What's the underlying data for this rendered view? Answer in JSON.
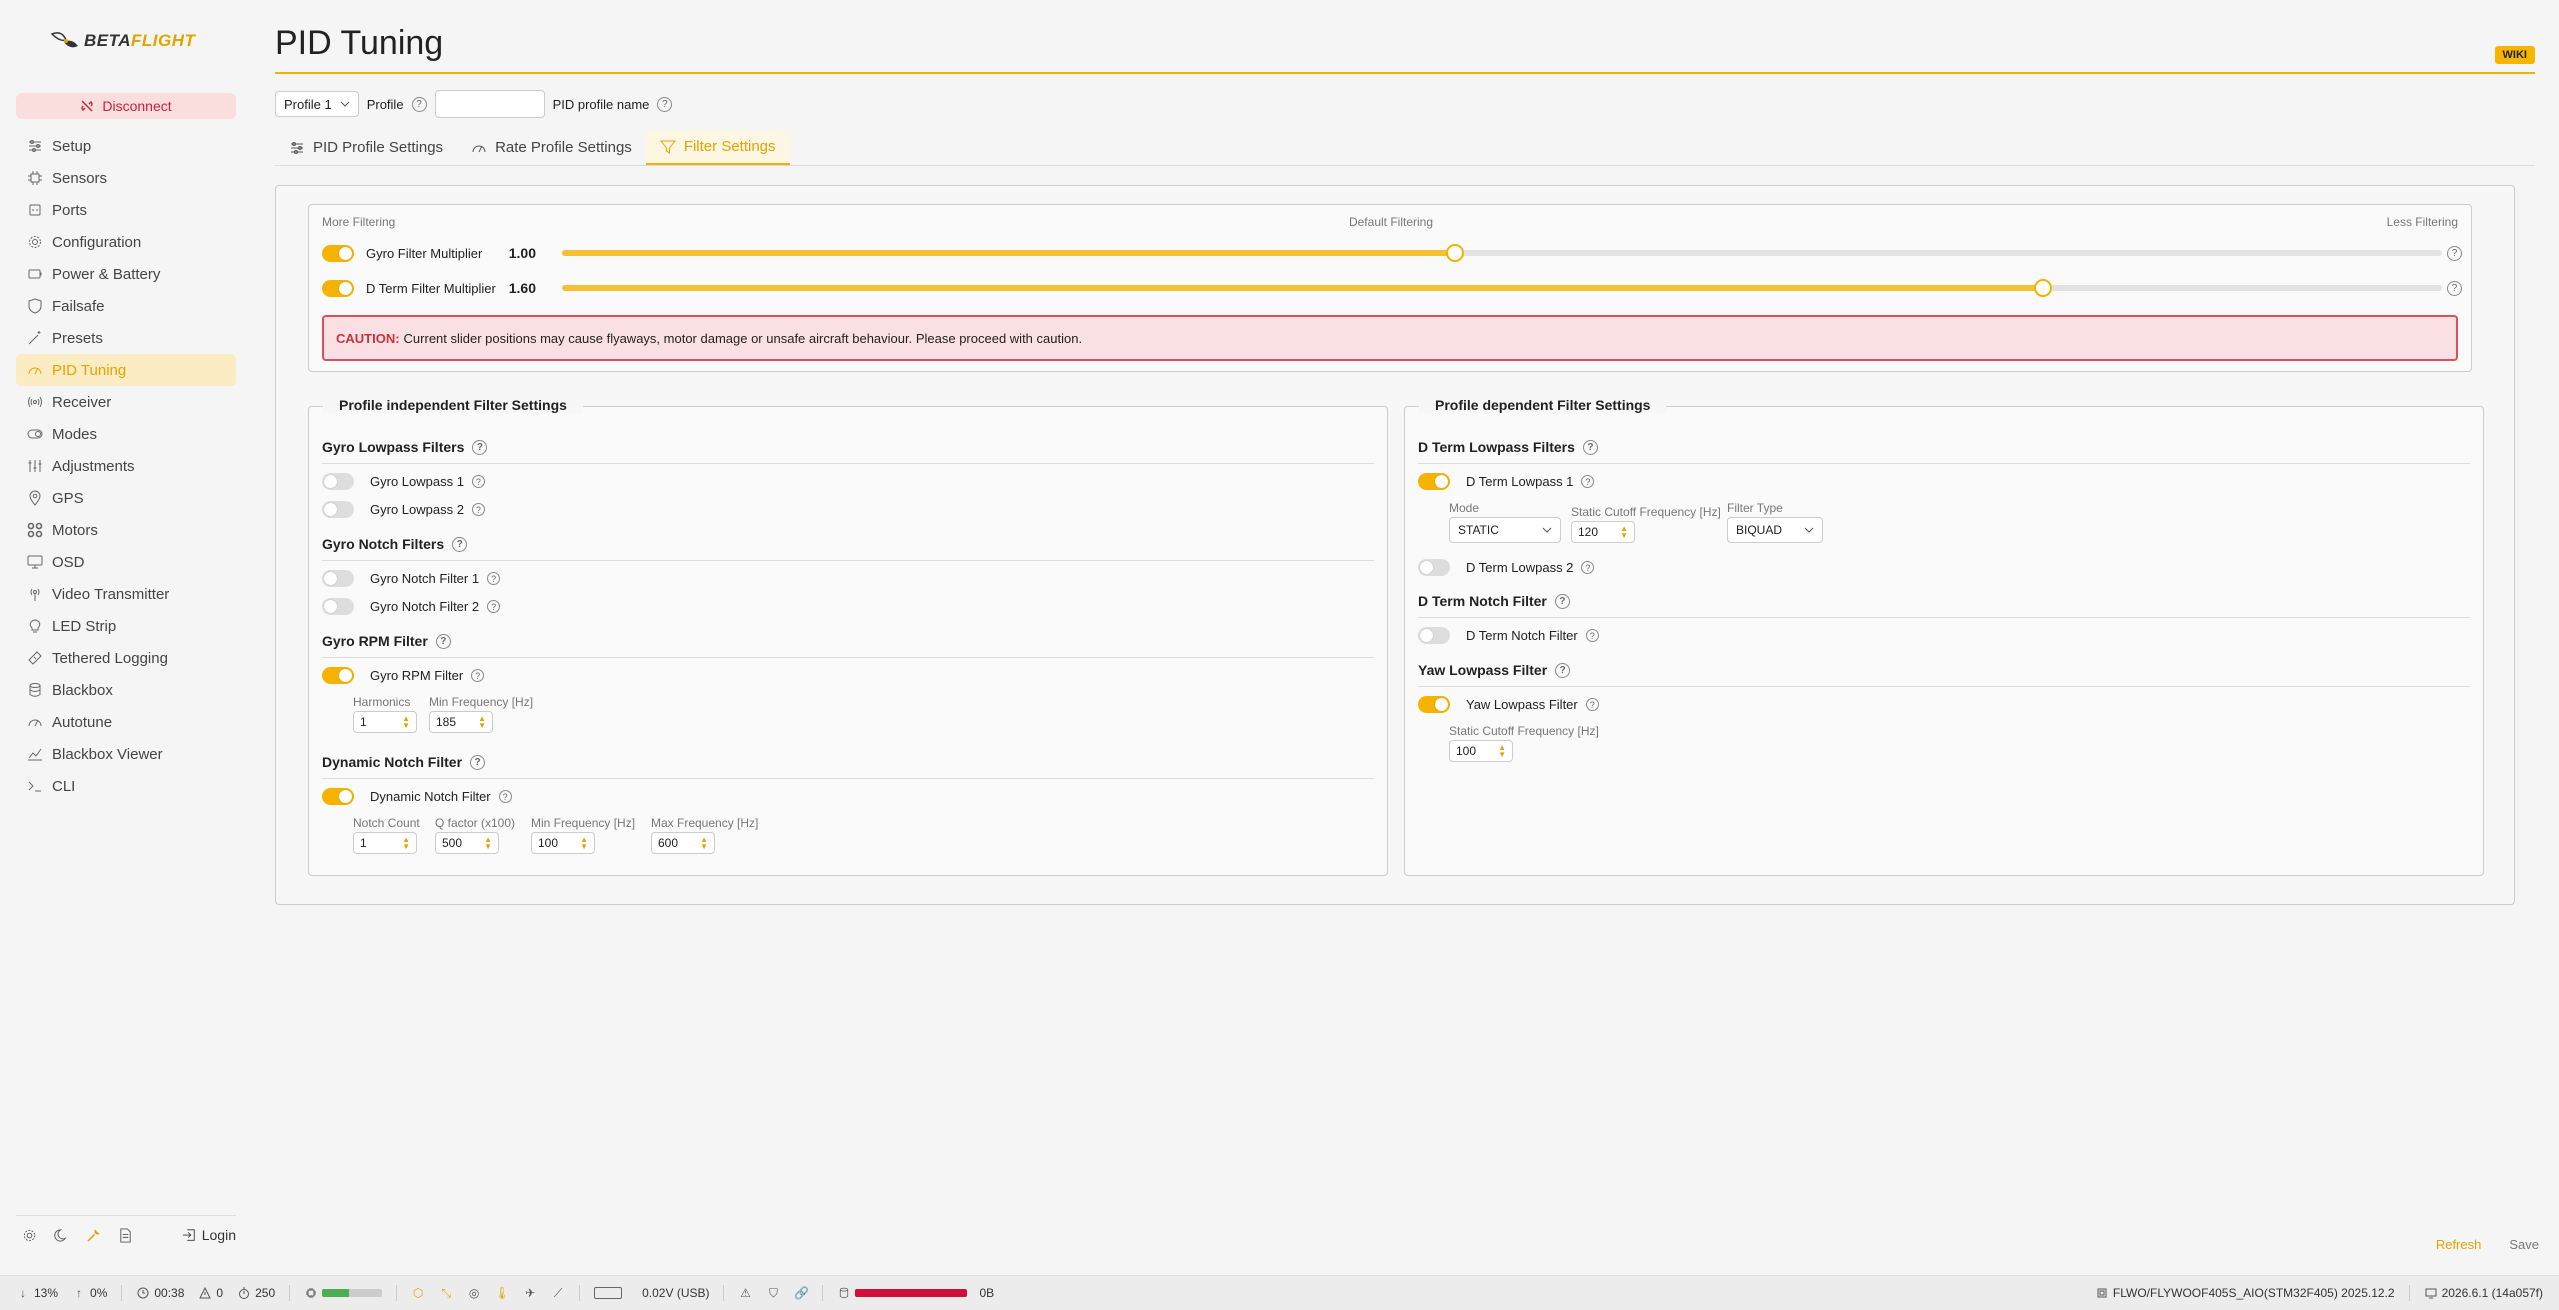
{
  "sidebar": {
    "logo_prefix": "BETA",
    "logo_suffix": "FLIGHT",
    "disconnect_label": "Disconnect",
    "items": [
      {
        "label": "Setup",
        "icon": "sliders-icon"
      },
      {
        "label": "Sensors",
        "icon": "chip-icon"
      },
      {
        "label": "Ports",
        "icon": "plug-icon"
      },
      {
        "label": "Configuration",
        "icon": "gear-icon"
      },
      {
        "label": "Power & Battery",
        "icon": "battery-icon"
      },
      {
        "label": "Failsafe",
        "icon": "shield-icon"
      },
      {
        "label": "Presets",
        "icon": "wand-icon"
      },
      {
        "label": "PID Tuning",
        "icon": "gauge-icon",
        "active": true
      },
      {
        "label": "Receiver",
        "icon": "antenna-icon"
      },
      {
        "label": "Modes",
        "icon": "toggle-icon"
      },
      {
        "label": "Adjustments",
        "icon": "adjust-icon"
      },
      {
        "label": "GPS",
        "icon": "pin-icon"
      },
      {
        "label": "Motors",
        "icon": "motor-icon"
      },
      {
        "label": "OSD",
        "icon": "monitor-icon"
      },
      {
        "label": "Video Transmitter",
        "icon": "broadcast-icon"
      },
      {
        "label": "LED Strip",
        "icon": "bulb-icon"
      },
      {
        "label": "Tethered Logging",
        "icon": "log-icon"
      },
      {
        "label": "Blackbox",
        "icon": "database-icon"
      },
      {
        "label": "Autotune",
        "icon": "gauge-icon"
      },
      {
        "label": "Blackbox Viewer",
        "icon": "chart-icon"
      },
      {
        "label": "CLI",
        "icon": "terminal-icon"
      }
    ],
    "login_label": "Login"
  },
  "header": {
    "title": "PID Tuning",
    "wiki_label": "WIKI"
  },
  "profile": {
    "select_value": "Profile 1",
    "profile_label": "Profile",
    "name_value": "",
    "name_label": "PID profile name"
  },
  "tabs": [
    {
      "label": "PID Profile Settings"
    },
    {
      "label": "Rate Profile Settings"
    },
    {
      "label": "Filter Settings",
      "active": true
    }
  ],
  "sliders": {
    "label_left": "More Filtering",
    "label_center": "Default Filtering",
    "label_right": "Less Filtering",
    "gyro": {
      "label": "Gyro Filter Multiplier",
      "value": "1.00",
      "fraction": 0.475,
      "enabled": true
    },
    "dterm": {
      "label": "D Term Filter Multiplier",
      "value": "1.60",
      "fraction": 0.788,
      "enabled": true
    },
    "caution_prefix": "CAUTION:",
    "caution_text": "Current slider positions may cause flyaways, motor damage or unsafe aircraft behaviour. Please proceed with caution."
  },
  "independent": {
    "legend": "Profile independent Filter Settings",
    "gyro_lowpass_title": "Gyro Lowpass Filters",
    "gyro_lowpass_1": "Gyro Lowpass 1",
    "gyro_lowpass_2": "Gyro Lowpass 2",
    "gyro_notch_title": "Gyro Notch Filters",
    "gyro_notch_1": "Gyro Notch Filter 1",
    "gyro_notch_2": "Gyro Notch Filter 2",
    "rpm_title": "Gyro RPM Filter",
    "rpm_label": "Gyro RPM Filter",
    "harmonics_label": "Harmonics",
    "harmonics_value": "1",
    "rpm_min_freq_label": "Min Frequency [Hz]",
    "rpm_min_freq_value": "185",
    "dyn_title": "Dynamic Notch Filter",
    "dyn_label": "Dynamic Notch Filter",
    "notch_count_label": "Notch Count",
    "notch_count_value": "1",
    "q_factor_label": "Q factor (x100)",
    "q_factor_value": "500",
    "dyn_min_freq_label": "Min Frequency [Hz]",
    "dyn_min_freq_value": "100",
    "dyn_max_freq_label": "Max Frequency [Hz]",
    "dyn_max_freq_value": "600"
  },
  "dependent": {
    "legend": "Profile dependent Filter Settings",
    "dterm_lowpass_title": "D Term Lowpass Filters",
    "dterm_lowpass_1": "D Term Lowpass 1",
    "mode_label": "Mode",
    "mode_value": "STATIC",
    "cutoff_label": "Static Cutoff Frequency [Hz]",
    "cutoff_value": "120",
    "filter_type_label": "Filter Type",
    "filter_type_value": "BIQUAD",
    "dterm_lowpass_2": "D Term Lowpass 2",
    "dterm_notch_title": "D Term Notch Filter",
    "dterm_notch_label": "D Term Notch Filter",
    "yaw_title": "Yaw Lowpass Filter",
    "yaw_label": "Yaw Lowpass Filter",
    "yaw_cutoff_label": "Static Cutoff Frequency [Hz]",
    "yaw_cutoff_value": "100"
  },
  "actions": {
    "refresh": "Refresh",
    "save": "Save"
  },
  "status": {
    "down_rate": "13%",
    "up_rate": "0%",
    "time": "00:38",
    "warnings": "0",
    "loop": "250",
    "cpu_fraction": 0.45,
    "voltage": "0.02V (USB)",
    "blackbox_fraction": 1.0,
    "blackbox_size": "0B",
    "firmware": "FLWO/FLYWOOF405S_AIO(STM32F405) 2025.12.2",
    "configurator": "2026.6.1 (14a057f)"
  },
  "colors": {
    "accent": "#f0b400",
    "danger": "#d9505e"
  }
}
